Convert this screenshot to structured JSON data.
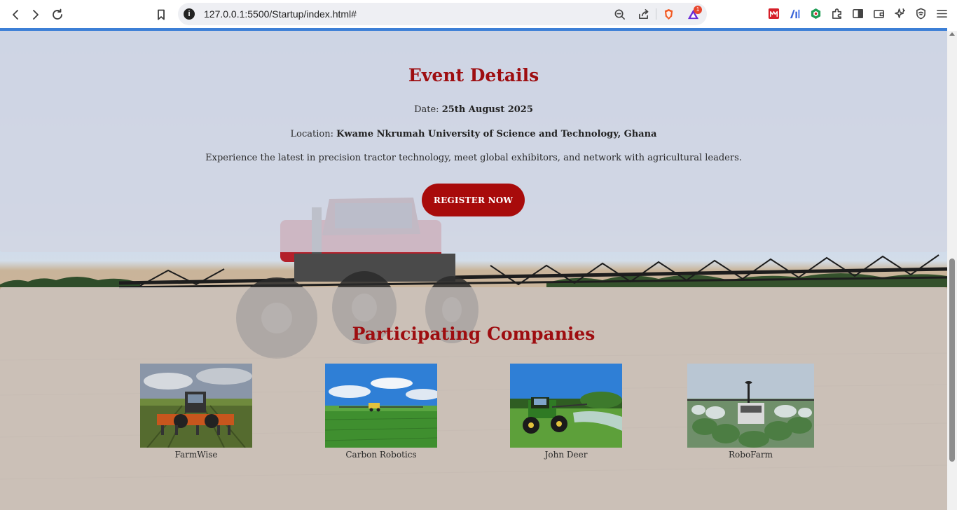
{
  "browser": {
    "url": "127.0.0.1:5500/Startup/index.html#",
    "notification_count": "1",
    "icons": [
      "back-icon",
      "forward-icon",
      "reload-icon",
      "bookmark-icon",
      "site-info-icon",
      "zoom-out-icon",
      "share-icon",
      "brave-shield-icon",
      "brave-rewards-icon",
      "extension-icon",
      "ai-extension-icon",
      "extension-green-icon",
      "puzzle-icon",
      "sidebar-icon",
      "wallet-icon",
      "leo-icon",
      "vpn-icon",
      "menu-icon"
    ]
  },
  "event": {
    "title": "Event Details",
    "date_label": "Date:",
    "date_value": "25th August 2025",
    "location_label": "Location:",
    "location_value": "Kwame Nkrumah University of Science and Technology, Ghana",
    "description": "Experience the latest in precision tractor technology, meet global exhibitors, and network with agricultural leaders.",
    "register_label": "REGISTER NOW"
  },
  "companies": {
    "title": "Participating Companies",
    "items": [
      {
        "name": "FarmWise"
      },
      {
        "name": "Carbon Robotics"
      },
      {
        "name": "John Deer"
      },
      {
        "name": "RoboFarm"
      }
    ]
  },
  "colors": {
    "accent": "#9e0d10",
    "button": "#a80b0b",
    "progress_bar": "#3c7fd6"
  }
}
